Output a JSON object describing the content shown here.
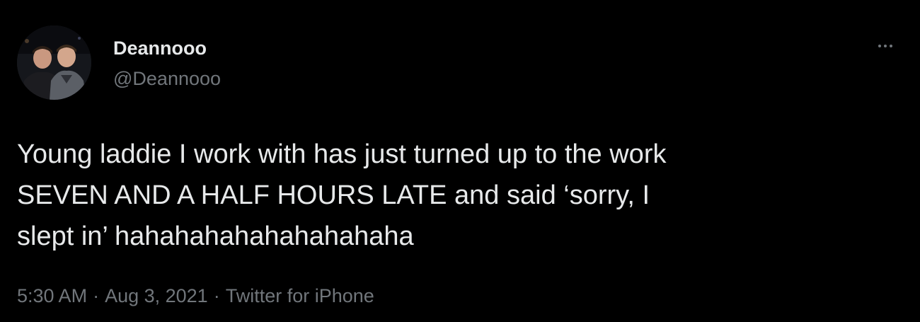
{
  "tweet": {
    "author": {
      "display_name": "Deannooo",
      "handle": "@Deannooo",
      "avatar_icon": "profile-photo"
    },
    "menu_icon": "more-options-icon",
    "text_lines": [
      "Young laddie I work with has just turned up to the work",
      "SEVEN AND A HALF HOURS LATE and said ‘sorry, I",
      "slept in’ hahahahahahahahahaha"
    ],
    "meta": {
      "time": "5:30 AM",
      "separator": "·",
      "date": "Aug 3, 2021",
      "source": "Twitter for iPhone"
    }
  },
  "colors": {
    "background": "#000000",
    "primary_text": "#e7e9ea",
    "secondary_text": "#71767b"
  }
}
